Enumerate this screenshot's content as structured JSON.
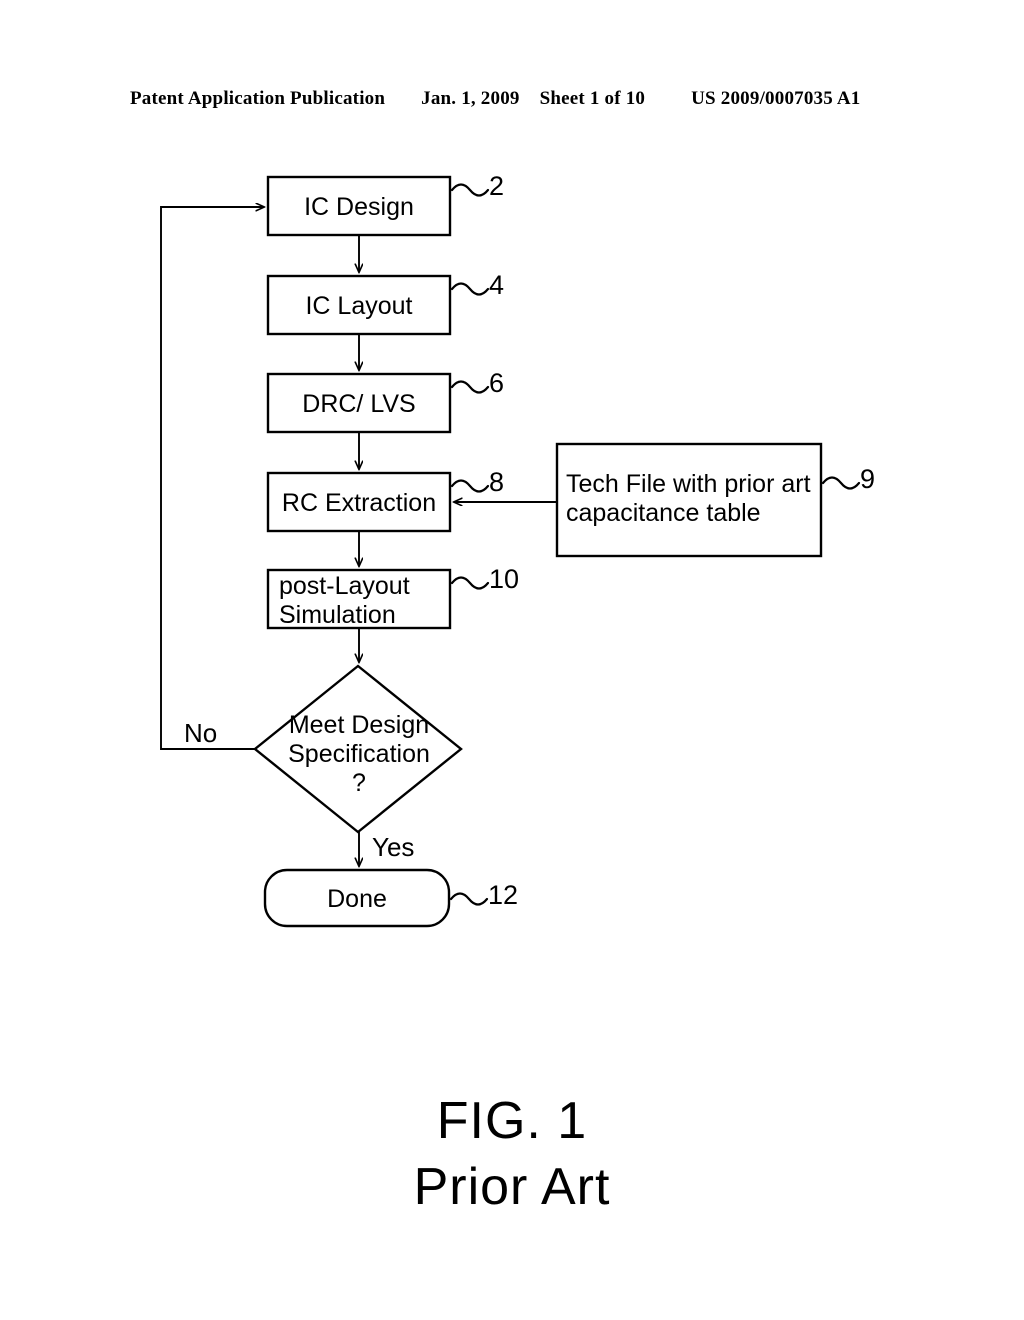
{
  "header": {
    "publication": "Patent Application Publication",
    "date": "Jan. 1, 2009",
    "sheet": "Sheet 1 of 10",
    "doc_number": "US 2009/0007035 A1"
  },
  "caption": {
    "line1": "FIG. 1",
    "line2": "Prior Art"
  },
  "diagram": {
    "type": "flowchart",
    "nodes": [
      {
        "id": "ic_design",
        "shape": "rectangle",
        "label": "IC Design",
        "ref": "2"
      },
      {
        "id": "ic_layout",
        "shape": "rectangle",
        "label": "IC Layout",
        "ref": "4"
      },
      {
        "id": "drc_lvs",
        "shape": "rectangle",
        "label": "DRC/ LVS",
        "ref": "6"
      },
      {
        "id": "rc_extraction",
        "shape": "rectangle",
        "label": "RC Extraction",
        "ref": "8"
      },
      {
        "id": "tech_file",
        "shape": "rectangle",
        "label": "Tech File with prior art\ncapacitance table",
        "ref": "9"
      },
      {
        "id": "post_layout_sim",
        "shape": "rectangle",
        "label": "post-Layout\nSimulation",
        "ref": "10"
      },
      {
        "id": "meet_spec",
        "shape": "diamond",
        "label": "Meet Design\nSpecification\n?",
        "ref": ""
      },
      {
        "id": "done",
        "shape": "rounded",
        "label": "Done",
        "ref": "12"
      }
    ],
    "edge_labels": {
      "no": "No",
      "yes": "Yes"
    }
  }
}
